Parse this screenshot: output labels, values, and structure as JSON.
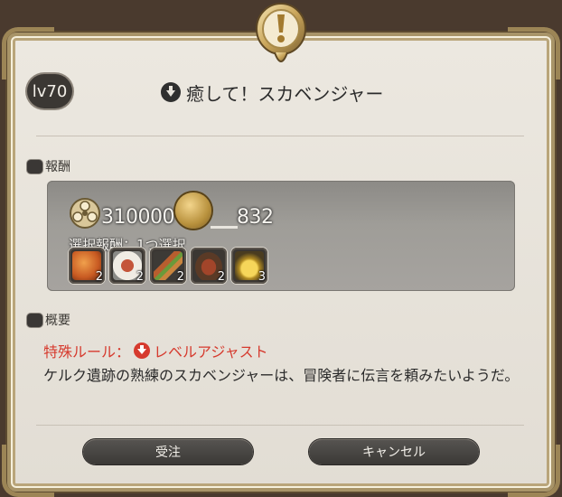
{
  "header": {
    "level": "lv70",
    "title": "癒して！スカベンジャー"
  },
  "rewards": {
    "label": "報酬",
    "gil": "310000",
    "seals": "832",
    "choice_label": "選択報酬：1つ選択",
    "items": [
      {
        "icon": "sausage-icon",
        "qty": "2"
      },
      {
        "icon": "plated-meal-icon",
        "qty": "2"
      },
      {
        "icon": "skewer-icon",
        "qty": "2"
      },
      {
        "icon": "stew-pot-icon",
        "qty": "2"
      },
      {
        "icon": "gold-pouch-icon",
        "qty": "3"
      }
    ]
  },
  "summary": {
    "label": "概要",
    "special_rule": "特殊ルール：",
    "level_adjust": "レベルアジャスト",
    "description": "ケルク遺跡の熟練のスカベンジャーは、冒険者に伝言を頼みたいようだ。"
  },
  "buttons": {
    "accept": "受注",
    "cancel": "キャンセル"
  },
  "colors": {
    "accent_red": "#d63a2e",
    "frame_gold": "#a89468",
    "panel_bg": "#e8e4dc"
  }
}
